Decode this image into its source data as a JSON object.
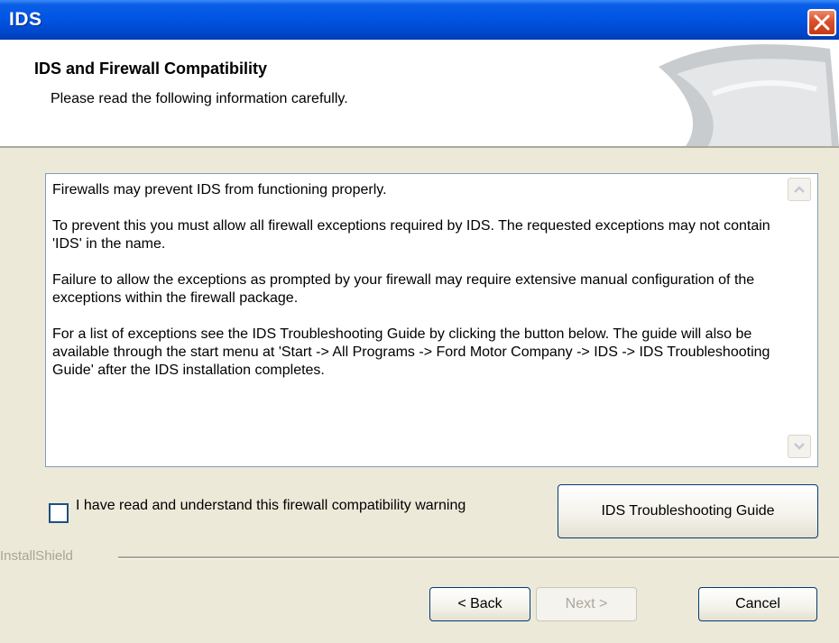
{
  "window": {
    "title": "IDS"
  },
  "header": {
    "title": "IDS and Firewall Compatibility",
    "subtitle": "Please read the following information carefully."
  },
  "info": {
    "paragraphs": [
      "Firewalls may prevent IDS from functioning properly.",
      "To prevent this you must allow all firewall exceptions required by IDS. The requested exceptions may not contain 'IDS' in the name.",
      "Failure to allow the exceptions as prompted by your firewall may require extensive manual configuration of the exceptions within the firewall package.",
      "For a list of exceptions see the IDS Troubleshooting Guide by clicking the button below. The guide will also be available through the start menu at 'Start -> All Programs -> Ford Motor Company -> IDS -> IDS Troubleshooting Guide' after the IDS installation completes."
    ]
  },
  "acknowledge": {
    "label": "I have read and understand this firewall compatibility warning",
    "checked": false
  },
  "buttons": {
    "guide": "IDS Troubleshooting Guide",
    "back": "< Back",
    "next": "Next >",
    "cancel": "Cancel"
  },
  "footer": {
    "brand": "InstallShield"
  },
  "icons": {
    "close": "close-icon",
    "scroll_up": "chevron-up-icon",
    "scroll_down": "chevron-down-icon"
  },
  "colors": {
    "titlebar": "#0054e3",
    "close": "#d9502b",
    "dialog_bg": "#ece9d8"
  }
}
